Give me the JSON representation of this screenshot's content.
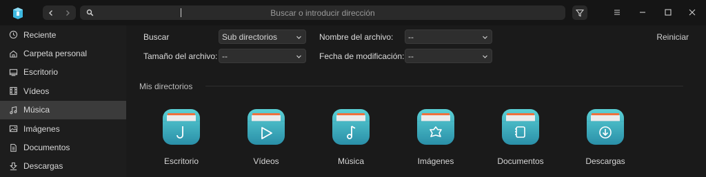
{
  "titlebar": {
    "address_placeholder": "Buscar o introducir dirección",
    "icons": [
      "app-logo",
      "back-icon",
      "forward-icon",
      "search-icon",
      "filter-icon",
      "menu-icon",
      "minimize-icon",
      "maximize-icon",
      "close-icon"
    ]
  },
  "sidebar": {
    "items": [
      {
        "label": "Reciente",
        "icon": "clock-icon"
      },
      {
        "label": "Carpeta personal",
        "icon": "home-icon"
      },
      {
        "label": "Escritorio",
        "icon": "desktop-icon"
      },
      {
        "label": "Vídeos",
        "icon": "film-icon"
      },
      {
        "label": "Música",
        "icon": "music-icon",
        "active": true
      },
      {
        "label": "Imágenes",
        "icon": "image-icon"
      },
      {
        "label": "Documentos",
        "icon": "document-icon"
      },
      {
        "label": "Descargas",
        "icon": "download-icon"
      }
    ]
  },
  "filters": {
    "search_label": "Buscar",
    "search_value": "Sub directorios",
    "size_label": "Tamaño del archivo:",
    "size_value": "--",
    "name_label": "Nombre del archivo:",
    "name_value": "--",
    "date_label": "Fecha de modificación:",
    "date_value": "--",
    "reset_label": "Reiniciar"
  },
  "directories": {
    "title": "Mis directorios",
    "items": [
      {
        "label": "Escritorio",
        "icon": "desktop-folder-icon"
      },
      {
        "label": "Vídeos",
        "icon": "videos-folder-icon"
      },
      {
        "label": "Música",
        "icon": "music-folder-icon"
      },
      {
        "label": "Imágenes",
        "icon": "images-folder-icon"
      },
      {
        "label": "Documentos",
        "icon": "documents-folder-icon"
      },
      {
        "label": "Descargas",
        "icon": "downloads-folder-icon"
      }
    ]
  },
  "colors": {
    "accent_teal": "#2fa9b6",
    "folder_top": "#5ad0d5",
    "folder_bottom": "#2a8fa8",
    "folder_tab": "#f0703c"
  }
}
